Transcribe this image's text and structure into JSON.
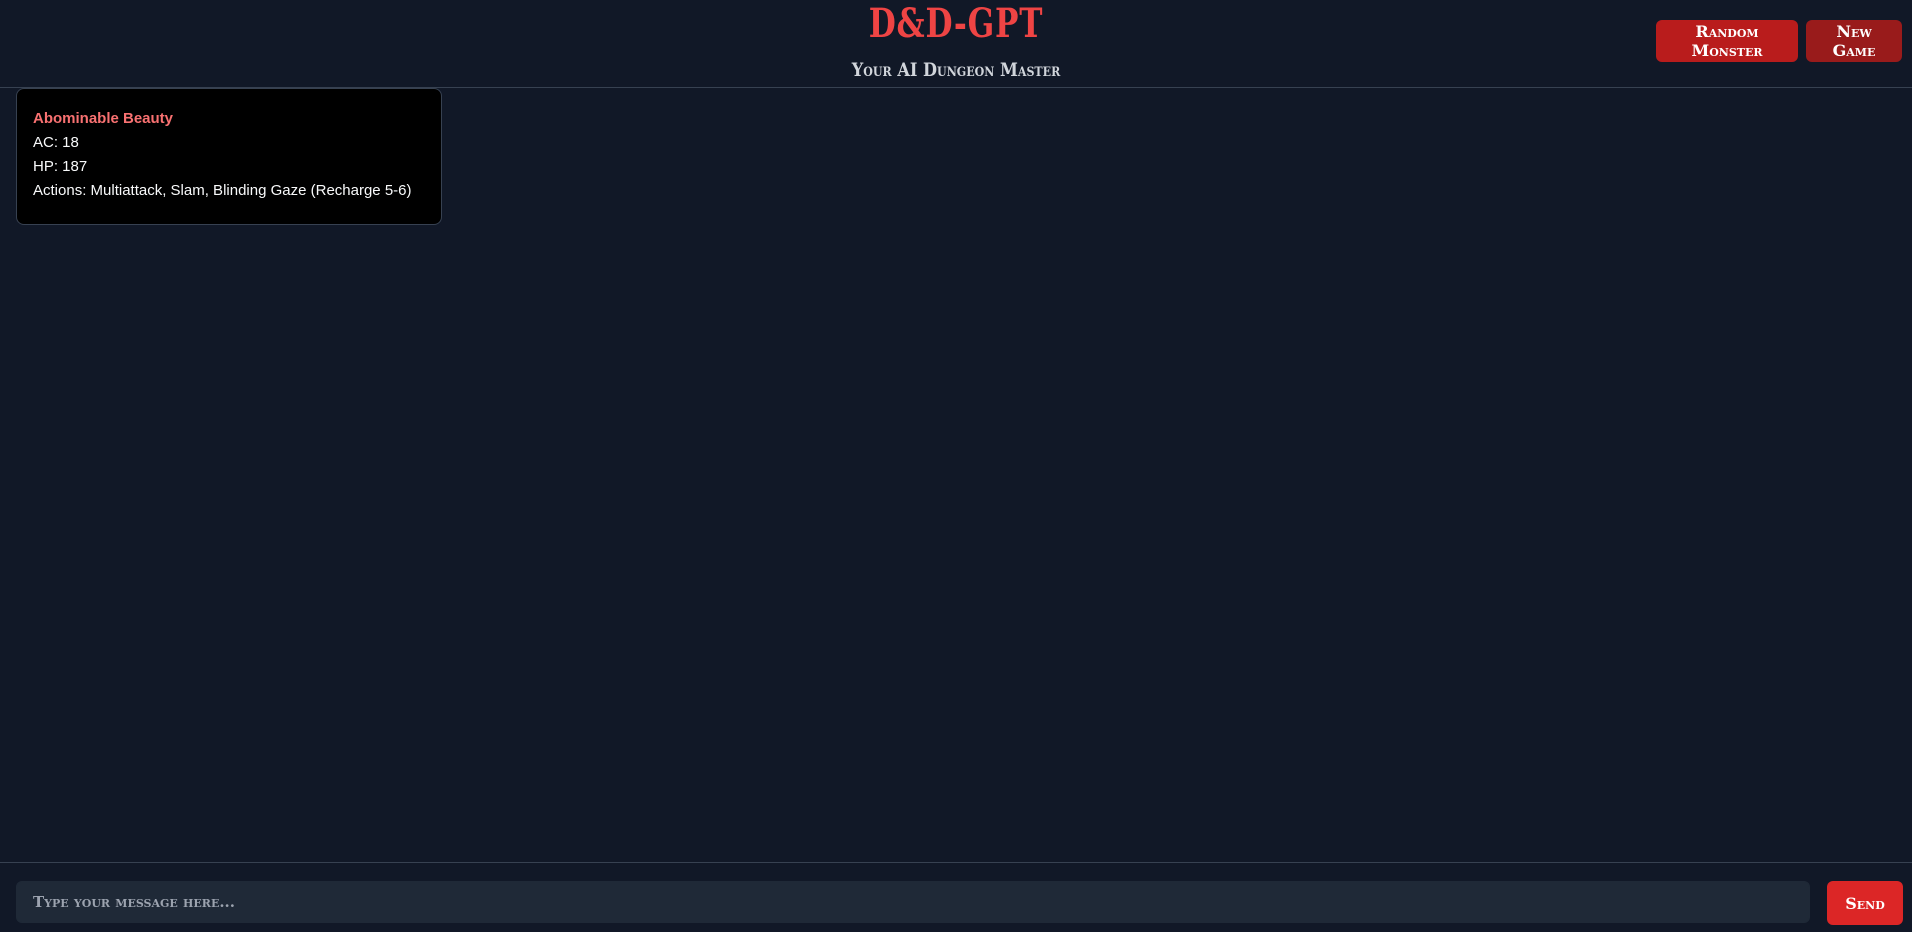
{
  "header": {
    "title": "D&D-GPT",
    "subtitle": "Your AI Dungeon Master",
    "random_monster_label": "Random Monster",
    "new_game_label": "New Game"
  },
  "monster": {
    "name": "Abominable Beauty",
    "ac": "AC: 18",
    "hp": "HP: 187",
    "actions": "Actions: Multiattack, Slam, Blinding Gaze (Recharge 5-6)"
  },
  "composer": {
    "placeholder": "Type your message here...",
    "value": "",
    "send_label": "Send"
  },
  "colors": {
    "background": "#111827",
    "accent": "#ef4444",
    "button": "#b91c1c",
    "card": "#000000"
  }
}
